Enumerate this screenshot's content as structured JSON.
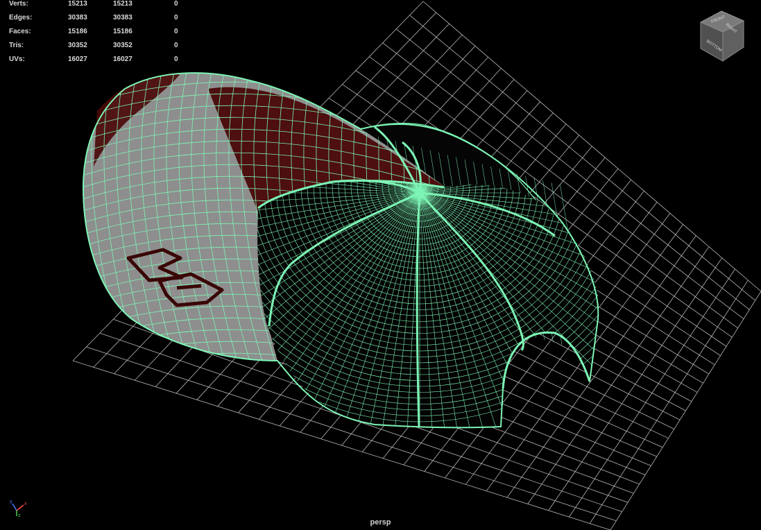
{
  "viewport": {
    "camera_name": "persp",
    "wireframe_color": "#7df5b5",
    "grid_color": "#b8b8b8",
    "background_color": "#000000",
    "shaded_base_color": "#9a9a9a",
    "shaded_accent_color": "#5a0a0a"
  },
  "hud": {
    "rows": [
      {
        "label": "Verts:",
        "col1": "15213",
        "col2": "15213",
        "col3": "0"
      },
      {
        "label": "Edges:",
        "col1": "30383",
        "col2": "30383",
        "col3": "0"
      },
      {
        "label": "Faces:",
        "col1": "15186",
        "col2": "15186",
        "col3": "0"
      },
      {
        "label": "Tris:",
        "col1": "30352",
        "col2": "30352",
        "col3": "0"
      },
      {
        "label": "UVs:",
        "col1": "16027",
        "col2": "16027",
        "col3": "0"
      }
    ]
  },
  "view_cube": {
    "faces": [
      "FRONT",
      "RIGHT",
      "BOTTOM"
    ]
  },
  "axis_indicator": {
    "labels": [
      "y",
      "x",
      "z"
    ],
    "colors": [
      "#4a7dff",
      "#ff4a4a",
      "#4ad24a"
    ]
  }
}
